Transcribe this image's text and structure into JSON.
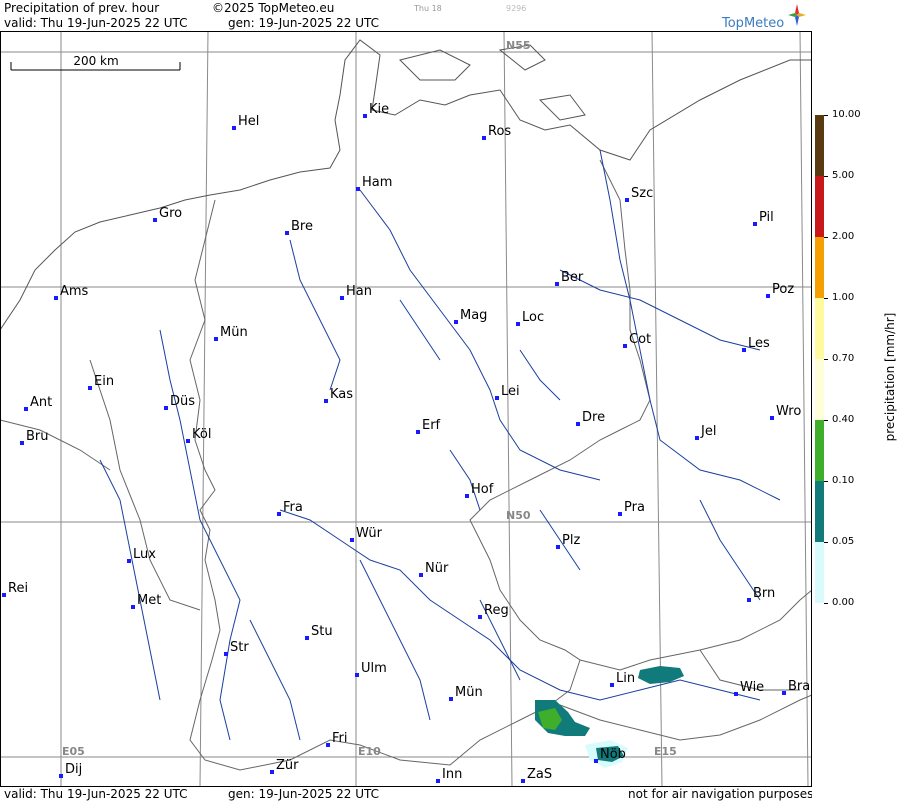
{
  "header": {
    "title": "Precipitation of prev. hour",
    "copyright": "©2025 TopMeteo.eu",
    "small_day": "Thu 18",
    "small_num": "9296",
    "valid": "valid:  Thu  19-Jun-2025  22 UTC",
    "gen": "gen: 19-Jun-2025 22 UTC",
    "logo": "TopMeteo"
  },
  "footer": {
    "valid": "valid:  Thu  19-Jun-2025  22 UTC",
    "gen": "gen: 19-Jun-2025 22 UTC",
    "disclaimer": "not for air navigation purposes"
  },
  "scale_label": "200 km",
  "grid_labels": {
    "n55": "N55",
    "n50": "N50",
    "e05": "E05",
    "e10": "E10",
    "e15": "E15"
  },
  "legend": {
    "title": "precipitation  [mm/hr]",
    "levels": [
      {
        "value": "10.00",
        "color": "#5a3a10"
      },
      {
        "value": "5.00",
        "color": "#c8181a"
      },
      {
        "value": "2.00",
        "color": "#f5a000"
      },
      {
        "value": "1.00",
        "color": "#fff9a0"
      },
      {
        "value": "0.70",
        "color": "#fefed8"
      },
      {
        "value": "0.40",
        "color": "#3fae2a"
      },
      {
        "value": "0.10",
        "color": "#117a7a"
      },
      {
        "value": "0.05",
        "color": "#d8fbfc"
      },
      {
        "value": "0.00",
        "color": "#ffffff"
      }
    ]
  },
  "cities": [
    {
      "name": "Kie"
    },
    {
      "name": "Hel"
    },
    {
      "name": "Ros"
    },
    {
      "name": "Ham"
    },
    {
      "name": "Szc"
    },
    {
      "name": "Gro"
    },
    {
      "name": "Bre"
    },
    {
      "name": "Pil"
    },
    {
      "name": "Ber"
    },
    {
      "name": "Ams"
    },
    {
      "name": "Han"
    },
    {
      "name": "Poz"
    },
    {
      "name": "Mag"
    },
    {
      "name": "Loc"
    },
    {
      "name": "Mün"
    },
    {
      "name": "Cot"
    },
    {
      "name": "Les"
    },
    {
      "name": "Ein"
    },
    {
      "name": "Kas"
    },
    {
      "name": "Lei"
    },
    {
      "name": "Ant"
    },
    {
      "name": "Düs"
    },
    {
      "name": "Wro"
    },
    {
      "name": "Dre"
    },
    {
      "name": "Erf"
    },
    {
      "name": "Bru"
    },
    {
      "name": "Köl"
    },
    {
      "name": "Jel"
    },
    {
      "name": "Hof"
    },
    {
      "name": "Fra"
    },
    {
      "name": "Pra"
    },
    {
      "name": "Wür"
    },
    {
      "name": "Plz"
    },
    {
      "name": "Lux"
    },
    {
      "name": "Nür"
    },
    {
      "name": "Rei"
    },
    {
      "name": "Brn"
    },
    {
      "name": "Met"
    },
    {
      "name": "Reg"
    },
    {
      "name": "Stu"
    },
    {
      "name": "Str"
    },
    {
      "name": "Lin"
    },
    {
      "name": "Ulm"
    },
    {
      "name": "Wie"
    },
    {
      "name": "Bra"
    },
    {
      "name": "Mün"
    },
    {
      "name": "Fri"
    },
    {
      "name": "Nöb"
    },
    {
      "name": "Dij"
    },
    {
      "name": "Zür"
    },
    {
      "name": "Inn"
    },
    {
      "name": "ZaS"
    }
  ]
}
